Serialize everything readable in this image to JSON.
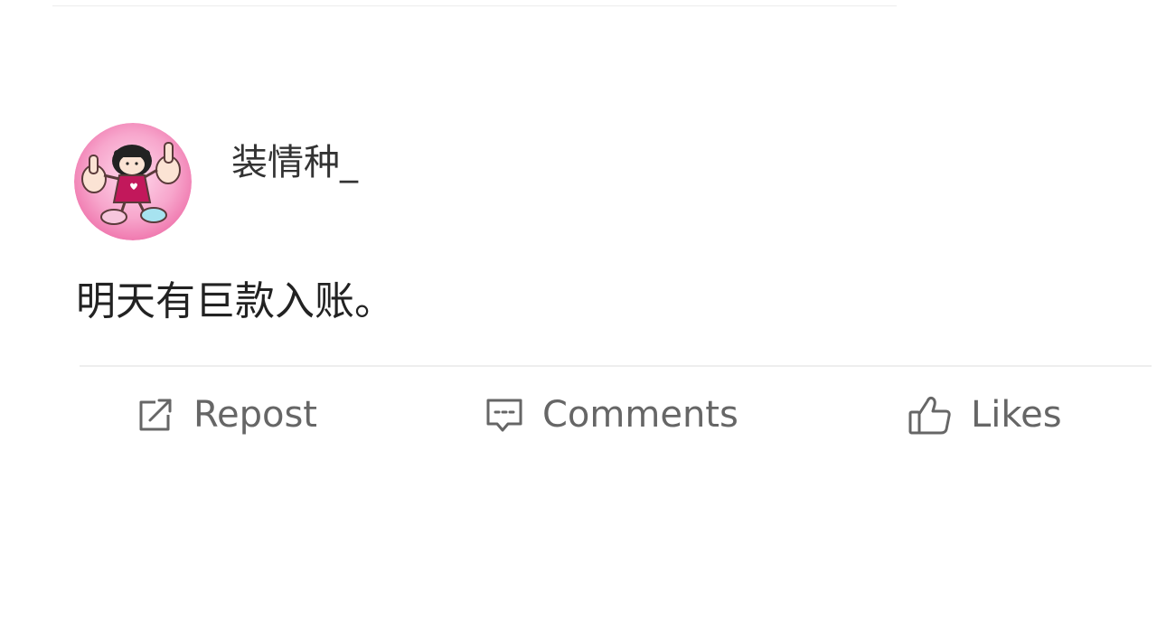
{
  "post": {
    "author": {
      "name": "装情种_",
      "avatar": "cartoon-girl-thumbs-up-avatar"
    },
    "text": "明天有巨款入账。"
  },
  "actions": {
    "repost": {
      "label": "Repost",
      "icon": "repost-icon"
    },
    "comments": {
      "label": "Comments",
      "icon": "comment-icon"
    },
    "likes": {
      "label": "Likes",
      "icon": "thumbs-up-icon"
    }
  },
  "colors": {
    "background": "#ffffff",
    "text_primary": "#222222",
    "text_secondary": "#666666",
    "divider": "#eeeeee",
    "avatar_pink": "#f06aa8"
  }
}
